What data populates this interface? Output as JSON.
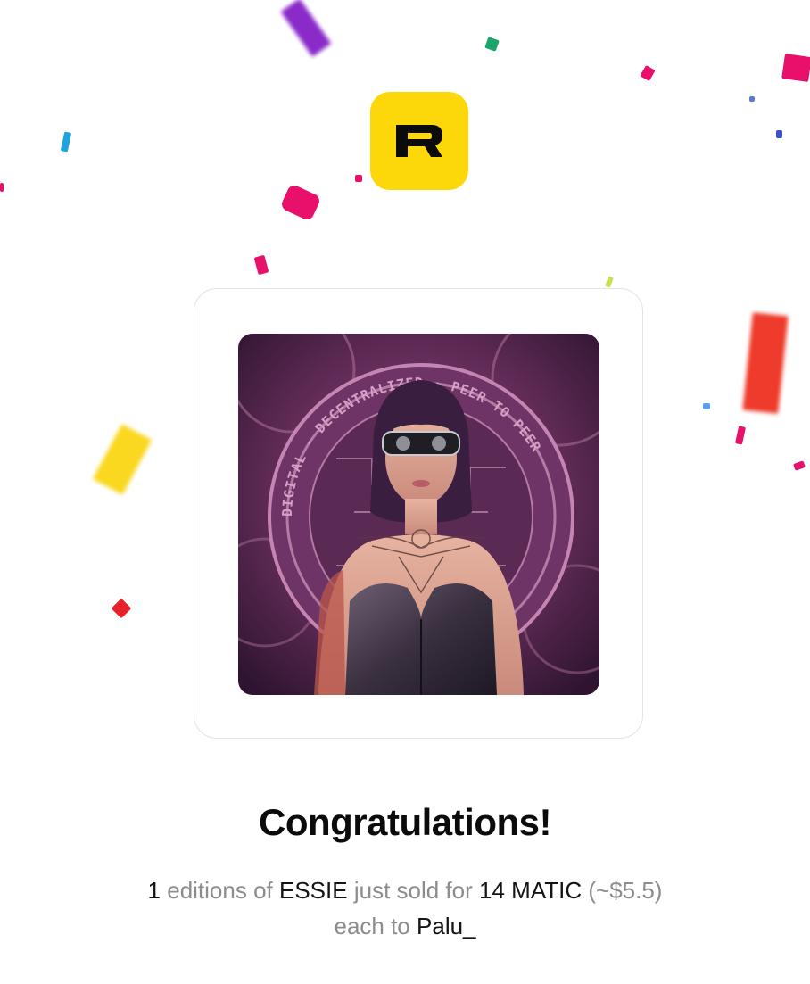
{
  "app": {
    "logo_letter": "R",
    "logo_color": "#fcd80a"
  },
  "nft": {
    "image_icon": "nft-artwork-image",
    "ring_text": "DIGITAL · DECENTRALIZED · PEER TO PEER"
  },
  "congrats": {
    "title": "Congratulations!",
    "quantity": "1",
    "editions_text": "editions of",
    "item_name": "ESSIE",
    "sold_text": "just sold for",
    "price": "14 MATIC",
    "usd_price": "(~$5.5)",
    "each_to_text": "each to",
    "buyer": "Palu_"
  }
}
